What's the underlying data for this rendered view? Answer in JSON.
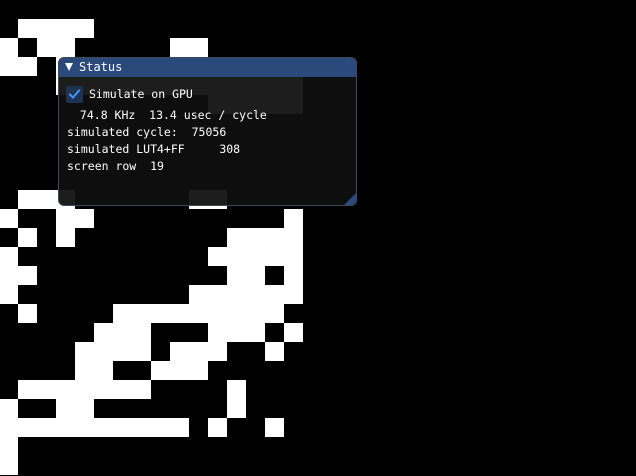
{
  "status_window": {
    "title": "Status",
    "simulate_on_gpu": {
      "label": "Simulate on GPU",
      "checked": true
    },
    "rate_line": " 74.8 KHz  13.4 usec / cycle",
    "cycle_line": "simulated cycle:  75056",
    "lut_line": "simulated LUT4+FF     308",
    "row_line": "screen row  19",
    "accent_color": "#294a7a",
    "checkmark_color": "#4296fa"
  },
  "simulation_view": {
    "cell_on_color": "#ffffff",
    "cell_off_color": "#000000",
    "rows": [
      "0000000000000000",
      "0111100000000000",
      "1011000001100000",
      "1101100000001111",
      "0001111111111111",
      "0000000000011111",
      "0000000000000000",
      "0000000000000000",
      "0000000000000000",
      "0000000000000000",
      "0111000000110000",
      "1001100000000001",
      "0101000000001111",
      "1000000000011111",
      "1100000000001101",
      "1000000000111111",
      "0100001111111110",
      "0000011100011101",
      "0000111101110010",
      "0000110011100000",
      "0111111100001000",
      "1001100000001000",
      "1111111111010010",
      "1000000000000000",
      "1000000000000000"
    ]
  }
}
